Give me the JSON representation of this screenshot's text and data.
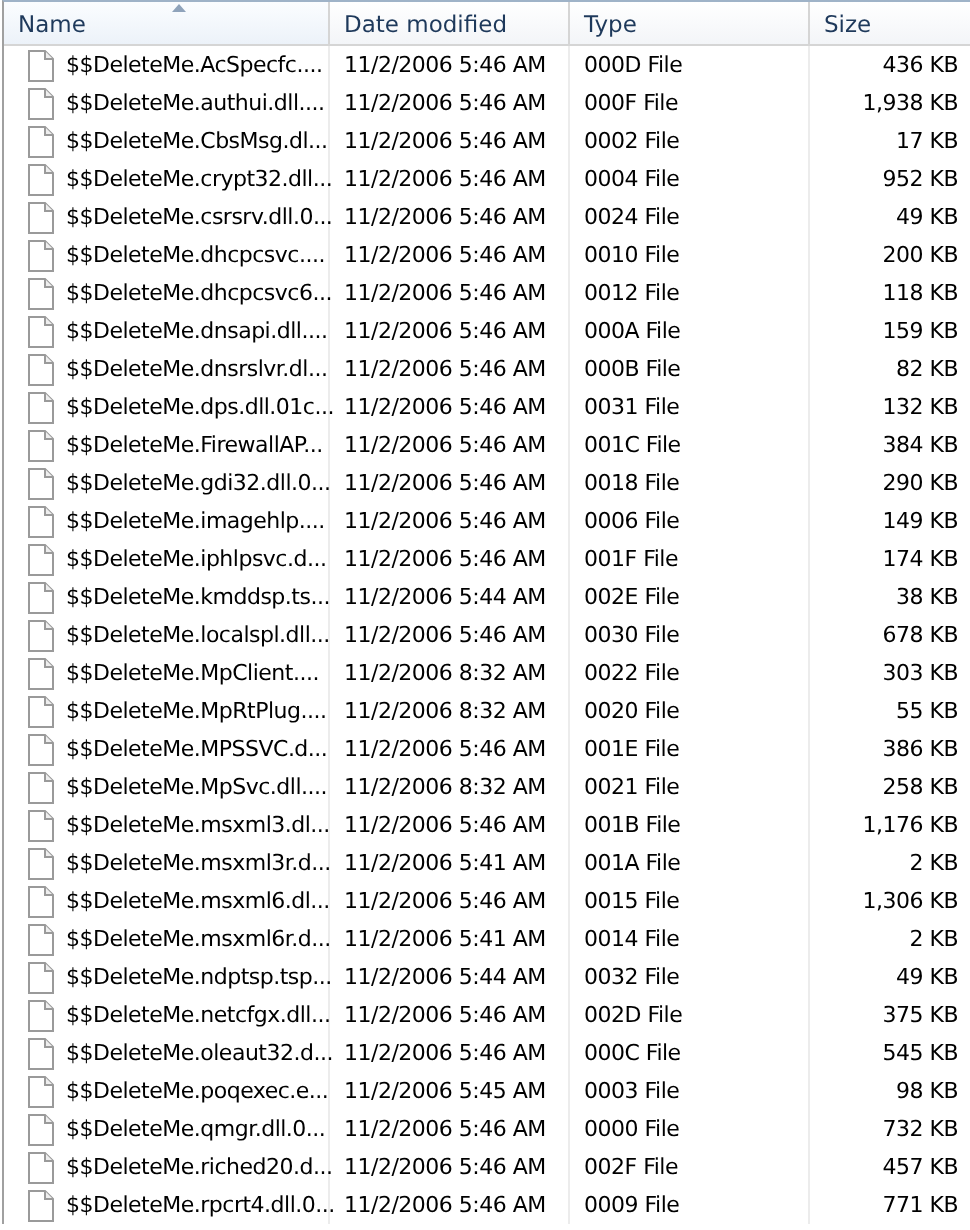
{
  "columns": [
    {
      "label": "Name",
      "sorted": true,
      "kind": "text"
    },
    {
      "label": "Date modified",
      "sorted": false,
      "kind": "text"
    },
    {
      "label": "Type",
      "sorted": false,
      "kind": "text"
    },
    {
      "label": "Size",
      "sorted": false,
      "kind": "number"
    }
  ],
  "rows": [
    [
      "$$DeleteMe.AcSpecfc....",
      "11/2/2006 5:46 AM",
      "000D File",
      "436 KB"
    ],
    [
      "$$DeleteMe.authui.dll....",
      "11/2/2006 5:46 AM",
      "000F File",
      "1,938 KB"
    ],
    [
      "$$DeleteMe.CbsMsg.dl...",
      "11/2/2006 5:46 AM",
      "0002 File",
      "17 KB"
    ],
    [
      "$$DeleteMe.crypt32.dll...",
      "11/2/2006 5:46 AM",
      "0004 File",
      "952 KB"
    ],
    [
      "$$DeleteMe.csrsrv.dll.0...",
      "11/2/2006 5:46 AM",
      "0024 File",
      "49 KB"
    ],
    [
      "$$DeleteMe.dhcpcsvc....",
      "11/2/2006 5:46 AM",
      "0010 File",
      "200 KB"
    ],
    [
      "$$DeleteMe.dhcpcsvc6...",
      "11/2/2006 5:46 AM",
      "0012 File",
      "118 KB"
    ],
    [
      "$$DeleteMe.dnsapi.dll....",
      "11/2/2006 5:46 AM",
      "000A File",
      "159 KB"
    ],
    [
      "$$DeleteMe.dnsrslvr.dl...",
      "11/2/2006 5:46 AM",
      "000B File",
      "82 KB"
    ],
    [
      "$$DeleteMe.dps.dll.01c...",
      "11/2/2006 5:46 AM",
      "0031 File",
      "132 KB"
    ],
    [
      "$$DeleteMe.FirewallAP...",
      "11/2/2006 5:46 AM",
      "001C File",
      "384 KB"
    ],
    [
      "$$DeleteMe.gdi32.dll.0...",
      "11/2/2006 5:46 AM",
      "0018 File",
      "290 KB"
    ],
    [
      "$$DeleteMe.imagehlp....",
      "11/2/2006 5:46 AM",
      "0006 File",
      "149 KB"
    ],
    [
      "$$DeleteMe.iphlpsvc.d...",
      "11/2/2006 5:46 AM",
      "001F File",
      "174 KB"
    ],
    [
      "$$DeleteMe.kmddsp.ts...",
      "11/2/2006 5:44 AM",
      "002E File",
      "38 KB"
    ],
    [
      "$$DeleteMe.localspl.dll...",
      "11/2/2006 5:46 AM",
      "0030 File",
      "678 KB"
    ],
    [
      "$$DeleteMe.MpClient....",
      "11/2/2006 8:32 AM",
      "0022 File",
      "303 KB"
    ],
    [
      "$$DeleteMe.MpRtPlug....",
      "11/2/2006 8:32 AM",
      "0020 File",
      "55 KB"
    ],
    [
      "$$DeleteMe.MPSSVC.d...",
      "11/2/2006 5:46 AM",
      "001E File",
      "386 KB"
    ],
    [
      "$$DeleteMe.MpSvc.dll....",
      "11/2/2006 8:32 AM",
      "0021 File",
      "258 KB"
    ],
    [
      "$$DeleteMe.msxml3.dl...",
      "11/2/2006 5:46 AM",
      "001B File",
      "1,176 KB"
    ],
    [
      "$$DeleteMe.msxml3r.d...",
      "11/2/2006 5:41 AM",
      "001A File",
      "2 KB"
    ],
    [
      "$$DeleteMe.msxml6.dl...",
      "11/2/2006 5:46 AM",
      "0015 File",
      "1,306 KB"
    ],
    [
      "$$DeleteMe.msxml6r.d...",
      "11/2/2006 5:41 AM",
      "0014 File",
      "2 KB"
    ],
    [
      "$$DeleteMe.ndptsp.tsp...",
      "11/2/2006 5:44 AM",
      "0032 File",
      "49 KB"
    ],
    [
      "$$DeleteMe.netcfgx.dll...",
      "11/2/2006 5:46 AM",
      "002D File",
      "375 KB"
    ],
    [
      "$$DeleteMe.oleaut32.d...",
      "11/2/2006 5:46 AM",
      "000C File",
      "545 KB"
    ],
    [
      "$$DeleteMe.poqexec.e...",
      "11/2/2006 5:45 AM",
      "0003 File",
      "98 KB"
    ],
    [
      "$$DeleteMe.qmgr.dll.0...",
      "11/2/2006 5:46 AM",
      "0000 File",
      "732 KB"
    ],
    [
      "$$DeleteMe.riched20.d...",
      "11/2/2006 5:46 AM",
      "002F File",
      "457 KB"
    ],
    [
      "$$DeleteMe.rpcrt4.dll.0...",
      "11/2/2006 5:46 AM",
      "0009 File",
      "771 KB"
    ]
  ]
}
